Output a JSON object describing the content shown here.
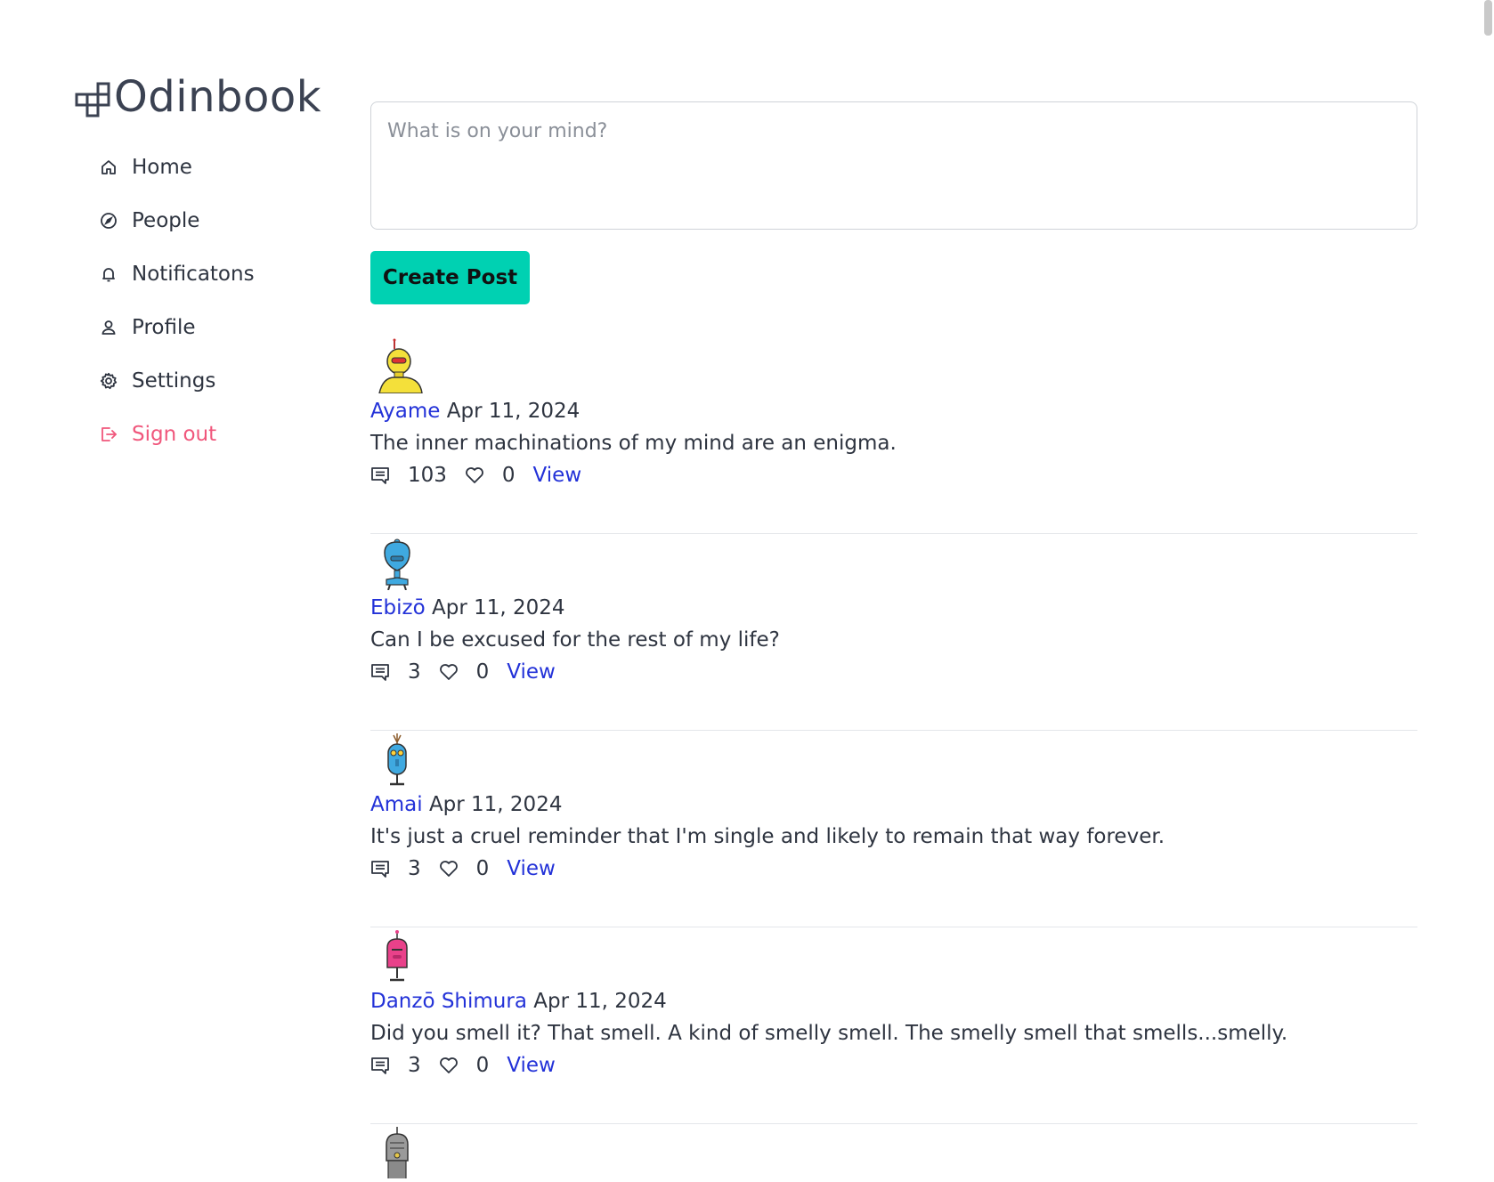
{
  "brand": {
    "name": "Odinbook"
  },
  "nav": {
    "items": [
      {
        "label": "Home",
        "icon": "home-icon"
      },
      {
        "label": "People",
        "icon": "compass-icon"
      },
      {
        "label": "Notificatons",
        "icon": "bell-icon"
      },
      {
        "label": "Profile",
        "icon": "user-icon"
      },
      {
        "label": "Settings",
        "icon": "gear-icon"
      },
      {
        "label": "Sign out",
        "icon": "sign-out-icon",
        "color": "#f0577c"
      }
    ]
  },
  "composer": {
    "placeholder": "What is on your mind?",
    "value": "",
    "button_label": "Create Post",
    "button_color": "#00d1b2"
  },
  "colors": {
    "link": "#2332d8",
    "danger": "#f0577c"
  },
  "posts": [
    {
      "author": "Ayame",
      "date": "Apr 11, 2024",
      "body": "The inner machinations of my mind are an enigma.",
      "comments": "103",
      "likes": "0",
      "view_label": "View",
      "avatar_color": "#f4e03a"
    },
    {
      "author": "Ebizō",
      "date": "Apr 11, 2024",
      "body": "Can I be excused for the rest of my life?",
      "comments": "3",
      "likes": "0",
      "view_label": "View",
      "avatar_color": "#3fa9e0"
    },
    {
      "author": "Amai",
      "date": "Apr 11, 2024",
      "body": "It's just a cruel reminder that I'm single and likely to remain that way forever.",
      "comments": "3",
      "likes": "0",
      "view_label": "View",
      "avatar_color": "#3fa9e0"
    },
    {
      "author": "Danzō Shimura",
      "date": "Apr 11, 2024",
      "body": "Did you smell it? That smell. A kind of smelly smell. The smelly smell that smells...smelly.",
      "comments": "3",
      "likes": "0",
      "view_label": "View",
      "avatar_color": "#e9418a"
    }
  ],
  "partial_post": {
    "avatar_color": "#9a9a9a"
  }
}
